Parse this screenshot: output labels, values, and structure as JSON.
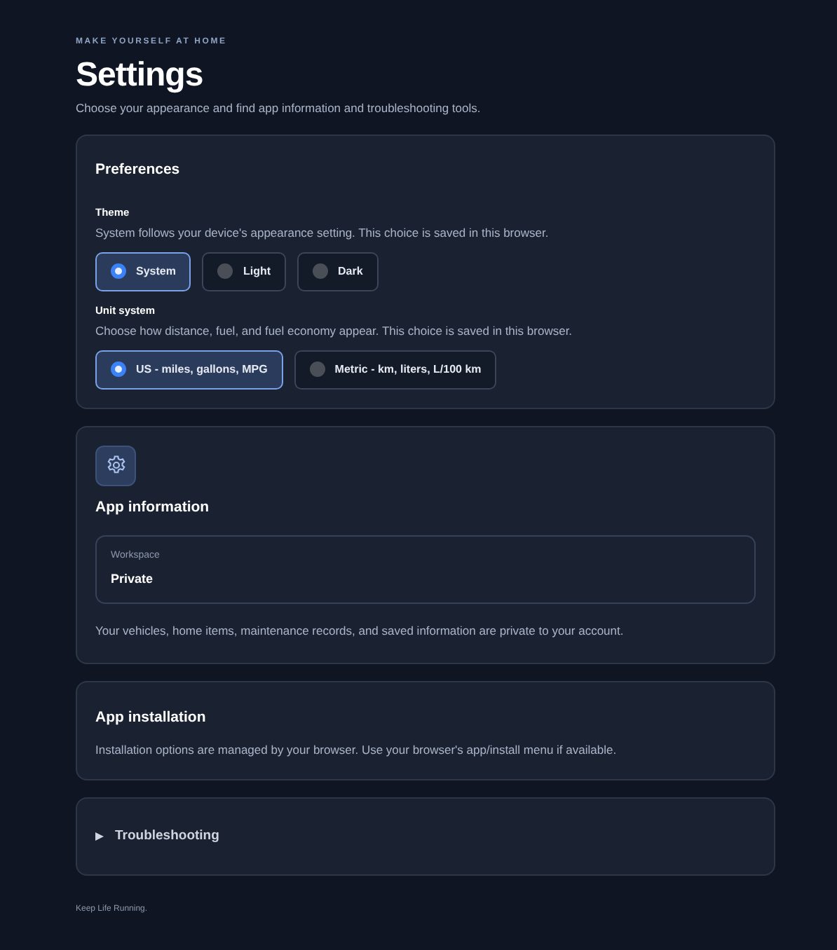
{
  "header": {
    "eyebrow": "MAKE YOURSELF AT HOME",
    "title": "Settings",
    "subtitle": "Choose your appearance and find app information and troubleshooting tools."
  },
  "preferences": {
    "title": "Preferences",
    "groups": [
      {
        "label": "Theme",
        "hint": "System follows your device's appearance setting. This choice is saved in this browser.",
        "options": [
          {
            "label": "System",
            "selected": true
          },
          {
            "label": "Light",
            "selected": false
          },
          {
            "label": "Dark",
            "selected": false
          }
        ]
      },
      {
        "label": "Unit system",
        "hint": "Choose how distance, fuel, and fuel economy appear. This choice is saved in this browser.",
        "options": [
          {
            "label": "US - miles, gallons, MPG",
            "selected": true
          },
          {
            "label": "Metric - km, liters, L/100 km",
            "selected": false
          }
        ]
      }
    ]
  },
  "app_information": {
    "title": "App information",
    "field": {
      "label": "Workspace",
      "value": "Private"
    },
    "note": "Your vehicles, home items, maintenance records, and saved information are private to your account."
  },
  "app_installation": {
    "title": "App installation",
    "note": "Installation options are managed by your browser. Use your browser's app/install menu if available."
  },
  "troubleshooting": {
    "title": "Troubleshooting",
    "expanded": false
  },
  "footer": "Keep Life Running."
}
